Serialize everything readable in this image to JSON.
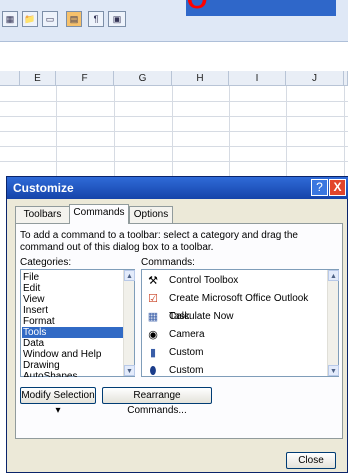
{
  "toolbar": {
    "icons": [
      "spreadsheet-icon",
      "folder-icon",
      "chart-icon",
      "grid-icon",
      "text-icon",
      "window-icon"
    ],
    "overlay_text": "o"
  },
  "sheet": {
    "columns": [
      "E",
      "F",
      "G",
      "H",
      "I",
      "J"
    ]
  },
  "dialog": {
    "title": "Customize",
    "help_label": "?",
    "close_label": "X",
    "tabs": [
      {
        "label": "Toolbars"
      },
      {
        "label": "Commands"
      },
      {
        "label": "Options"
      }
    ],
    "instructions": "To add a command to a toolbar: select a category and drag the command out of this dialog box to a toolbar.",
    "categories_label": "Categories:",
    "commands_label": "Commands:",
    "categories": [
      "File",
      "Edit",
      "View",
      "Insert",
      "Format",
      "Tools",
      "Data",
      "Window and Help",
      "Drawing",
      "AutoShapes"
    ],
    "selected_category": "Tools",
    "commands": [
      {
        "label": "Control Toolbox",
        "icon": "hammer-icon"
      },
      {
        "label": "Create Microsoft Office Outlook Task",
        "icon": "task-icon"
      },
      {
        "label": "Calculate Now",
        "icon": "calculator-icon"
      },
      {
        "label": "Camera",
        "icon": "camera-icon"
      },
      {
        "label": "Custom",
        "icon": "custom-icon"
      },
      {
        "label": "Custom",
        "icon": "custom-icon"
      }
    ],
    "modify_selection_label": "Modify Selection ▾",
    "rearrange_label": "Rearrange Commands...",
    "close_button_label": "Close"
  },
  "colors": {
    "titlebar": "#1d4fc0",
    "selected": "#316ac5",
    "dialog_bg": "#ece9d8"
  }
}
